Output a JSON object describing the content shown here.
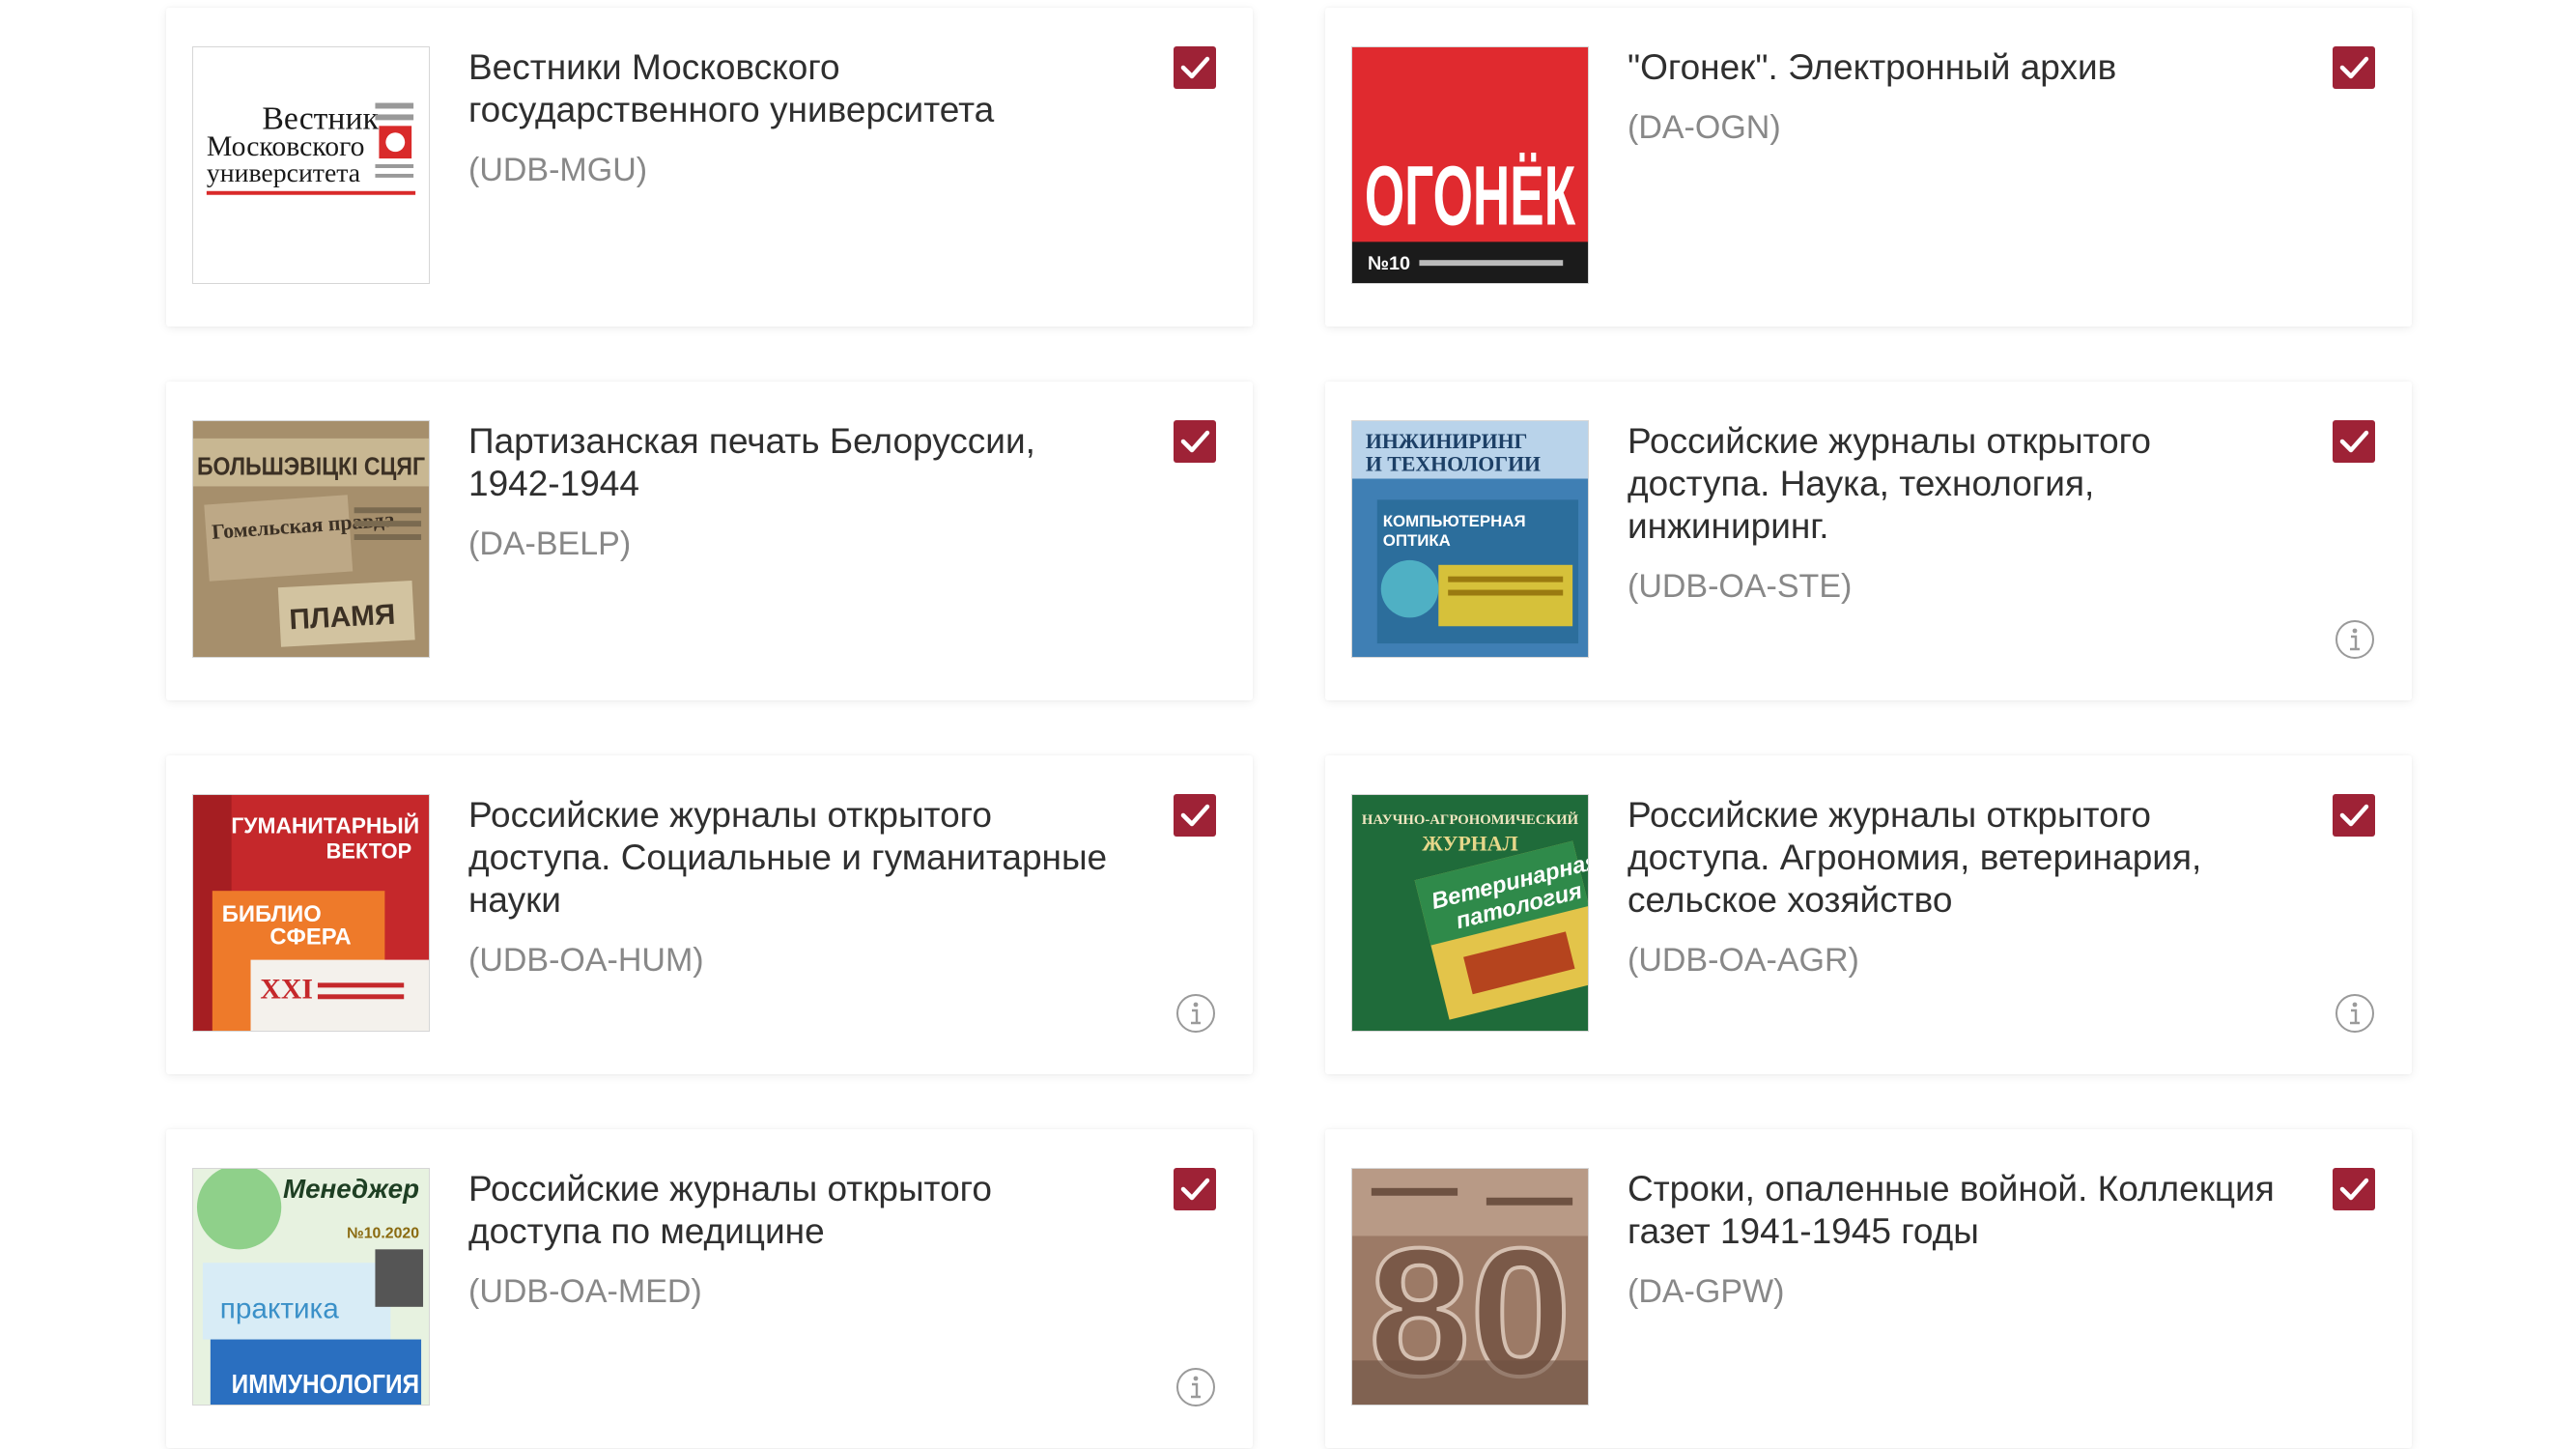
{
  "accent_color": "#9e2236",
  "cards": [
    {
      "title": "Вестники Московского\nгосударственного университета",
      "code": "(UDB-MGU)",
      "checked": true,
      "has_info": false,
      "thumb_icon": "vestnik-mgu-cover-icon",
      "thumb_text": [
        "Вестник",
        "Московского",
        "университета"
      ]
    },
    {
      "title": "\"Огонек\". Электронный архив",
      "code": "(DA-OGN)",
      "checked": true,
      "has_info": false,
      "thumb_icon": "ogonek-cover-icon",
      "thumb_text": [
        "ОГОНЁК",
        "№10"
      ]
    },
    {
      "title": "Партизанская печать Белоруссии,\n1942-1944",
      "code": "(DA-BELP)",
      "checked": true,
      "has_info": false,
      "thumb_icon": "partisan-newspapers-icon",
      "thumb_text": [
        "БОЛЬШЭВІЦКІ СЦЯГ",
        "Гомельская правда",
        "ПЛАМЯ"
      ]
    },
    {
      "title": "Российские журналы открытого\nдоступа.  Наука, технология,\nинжиниринг.",
      "code": "(UDB-OA-STE)",
      "checked": true,
      "has_info": true,
      "thumb_icon": "engineering-journals-icon",
      "thumb_text": [
        "ИНЖИНИРИНГ",
        "И ТЕХНОЛОГИИ",
        "КОМПЬЮТЕРНАЯ",
        "ОПТИКА"
      ]
    },
    {
      "title": "Российские журналы открытого\nдоступа. Социальные и гуманитарные\nнауки",
      "code": "(UDB-OA-HUM)",
      "checked": true,
      "has_info": true,
      "thumb_icon": "humanities-journals-icon",
      "thumb_text": [
        "ГУМАНИТАРНЫЙ",
        "ВЕКТОР",
        "БИБЛИО",
        "СФЕРА",
        "XXI"
      ]
    },
    {
      "title": "Российские журналы открытого\nдоступа. Агрономия, ветеринария,\nсельское хозяйство",
      "code": "(UDB-OA-AGR)",
      "checked": true,
      "has_info": true,
      "thumb_icon": "agronomy-journals-icon",
      "thumb_text": [
        "НАУЧНО-АГРОНОМИЧЕСКИЙ",
        "ЖУРНАЛ",
        "Ветеринарная",
        "патология"
      ]
    },
    {
      "title": "Российские журналы открытого\nдоступа по медицине",
      "code": "(UDB-OA-MED)",
      "checked": true,
      "has_info": true,
      "thumb_icon": "medicine-journals-icon",
      "thumb_text": [
        "Менеджер",
        "№10.2020",
        "практика",
        "ИММУНОЛОГИЯ"
      ]
    },
    {
      "title": "Строки, опаленные войной. Коллекция\nгазет 1941-1945 годы",
      "code": "(DA-GPW)",
      "checked": true,
      "has_info": false,
      "thumb_icon": "war-newspapers-80-icon",
      "thumb_text": [
        "80"
      ]
    }
  ]
}
